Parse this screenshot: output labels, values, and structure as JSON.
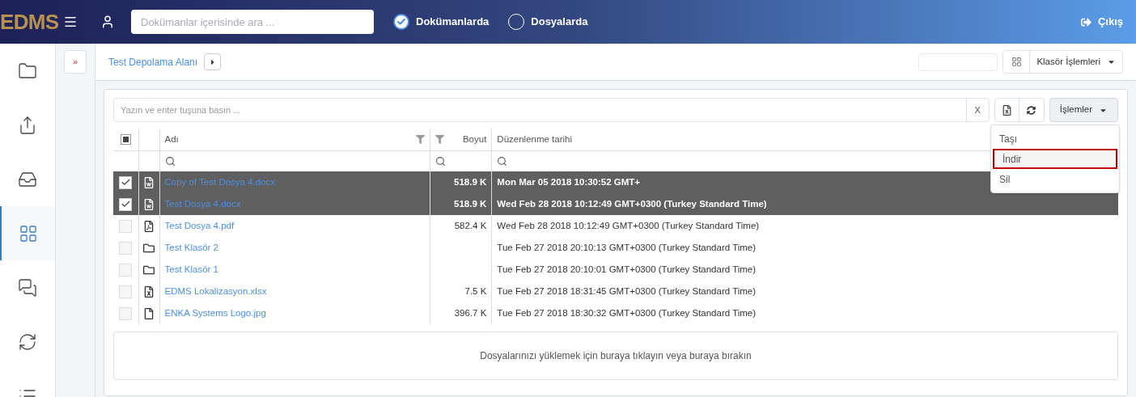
{
  "header": {
    "logo": "EDMS",
    "search": {
      "placeholder": "Dokümanlar içerisinde ara ..."
    },
    "scope_options": [
      {
        "label": "Dokümanlarda",
        "selected": true
      },
      {
        "label": "Dosyalarda",
        "selected": false
      }
    ],
    "logout": "Çıkış"
  },
  "sidebar": {
    "items": [
      {
        "kind": "folder",
        "selected": false
      },
      {
        "kind": "share",
        "selected": false
      },
      {
        "kind": "inbox",
        "selected": false
      },
      {
        "kind": "grid",
        "selected": true
      },
      {
        "kind": "chat",
        "selected": false
      },
      {
        "kind": "sync",
        "selected": false
      },
      {
        "kind": "list",
        "selected": false
      }
    ]
  },
  "expand_button": "»",
  "breadcrumb": {
    "items": [
      "Test Depolama Alanı"
    ]
  },
  "folder_actions": "Klasör İşlemleri",
  "grid": {
    "filter": {
      "placeholder": "Yazın ve enter tuşuna basın ...",
      "clear": "X"
    },
    "actions_button": "İşlemler",
    "actions_menu": [
      {
        "label": "Taşı",
        "highlighted": false
      },
      {
        "label": "İndir",
        "highlighted": true
      },
      {
        "label": "Sil",
        "highlighted": false
      }
    ],
    "select_all_partial": true,
    "columns": [
      "Adı",
      "Boyut",
      "Düzenlenme tarihi"
    ],
    "rows": [
      {
        "kind": "word",
        "name": "Copy of Test Dosya 4.docx",
        "size": "518.9 K",
        "modified": "Mon Mar 05 2018 10:30:52 GMT+",
        "selected": true
      },
      {
        "kind": "word",
        "name": "Test Dosya 4.docx",
        "size": "518.9 K",
        "modified": "Wed Feb 28 2018 10:12:49 GMT+0300 (Turkey Standard Time)",
        "selected": true
      },
      {
        "kind": "pdf",
        "name": "Test Dosya 4.pdf",
        "size": "582.4 K",
        "modified": "Wed Feb 28 2018 10:12:49 GMT+0300 (Turkey Standard Time)",
        "selected": false
      },
      {
        "kind": "folder",
        "name": "Test Klasör 2",
        "modified": "Tue Feb 27 2018 20:10:13 GMT+0300 (Turkey Standard Time)",
        "selected": false
      },
      {
        "kind": "folder",
        "name": "Test Klasör 1",
        "modified": "Tue Feb 27 2018 20:10:01 GMT+0300 (Turkey Standard Time)",
        "selected": false
      },
      {
        "kind": "excel",
        "name": "EDMS Lokalizasyon.xlsx",
        "size": "7.5 K",
        "modified": "Tue Feb 27 2018 18:31:45 GMT+0300 (Turkey Standard Time)",
        "selected": false
      },
      {
        "kind": "file",
        "name": "ENKA Systems Logo.jpg",
        "size": "396.7 K",
        "modified": "Tue Feb 27 2018 18:30:32 GMT+0300 (Turkey Standard Time)",
        "selected": false
      }
    ],
    "upload_zone": "Dosyalarınızı yüklemek için buraya tıklayın veya buraya bırakın"
  }
}
